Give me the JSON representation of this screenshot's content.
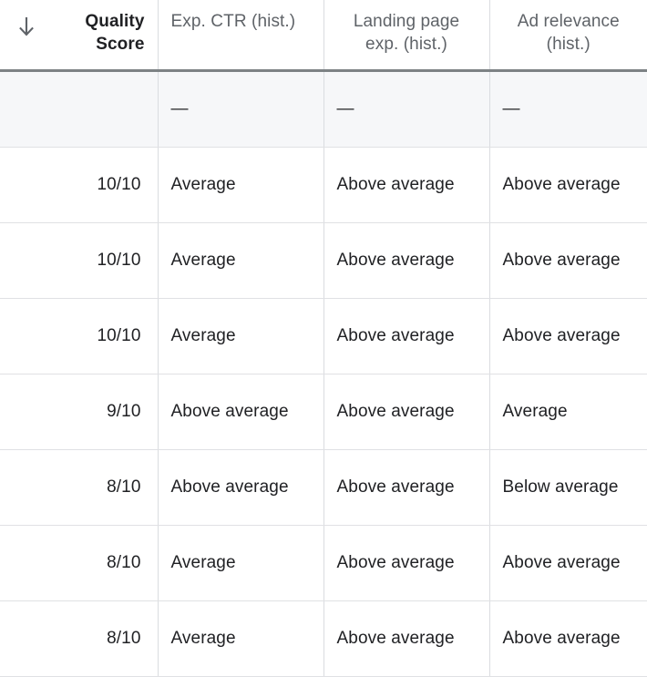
{
  "table": {
    "sort_icon": "arrow-down-icon",
    "columns": [
      {
        "key": "quality_score",
        "label": "Quality Score",
        "bold": true,
        "align": "right"
      },
      {
        "key": "exp_ctr",
        "label": "Exp. CTR (hist.)",
        "bold": false,
        "align": "left"
      },
      {
        "key": "landing_page",
        "label": "Landing page exp. (hist.)",
        "bold": false,
        "align": "left"
      },
      {
        "key": "ad_relevance",
        "label": "Ad relevance (hist.)",
        "bold": false,
        "align": "left"
      }
    ],
    "summary_row": {
      "quality_score": "",
      "exp_ctr": "—",
      "landing_page": "—",
      "ad_relevance": "—"
    },
    "rows": [
      {
        "quality_score": "10/10",
        "exp_ctr": "Average",
        "landing_page": "Above average",
        "ad_relevance": "Above average"
      },
      {
        "quality_score": "10/10",
        "exp_ctr": "Average",
        "landing_page": "Above average",
        "ad_relevance": "Above average"
      },
      {
        "quality_score": "10/10",
        "exp_ctr": "Average",
        "landing_page": "Above average",
        "ad_relevance": "Above average"
      },
      {
        "quality_score": "9/10",
        "exp_ctr": "Above average",
        "landing_page": "Above average",
        "ad_relevance": "Average"
      },
      {
        "quality_score": "8/10",
        "exp_ctr": "Above average",
        "landing_page": "Above average",
        "ad_relevance": "Below average"
      },
      {
        "quality_score": "8/10",
        "exp_ctr": "Average",
        "landing_page": "Above average",
        "ad_relevance": "Above average"
      },
      {
        "quality_score": "8/10",
        "exp_ctr": "Average",
        "landing_page": "Above average",
        "ad_relevance": "Above average"
      }
    ]
  },
  "colors": {
    "header_text": "#5f6368",
    "header_bold_text": "#202124",
    "body_text": "#202124",
    "grid_line": "#dadce0",
    "row_line": "#e0e1e4",
    "header_rule": "#7d8285",
    "summary_bg": "#f6f7f9",
    "page_bg": "#ffffff"
  }
}
